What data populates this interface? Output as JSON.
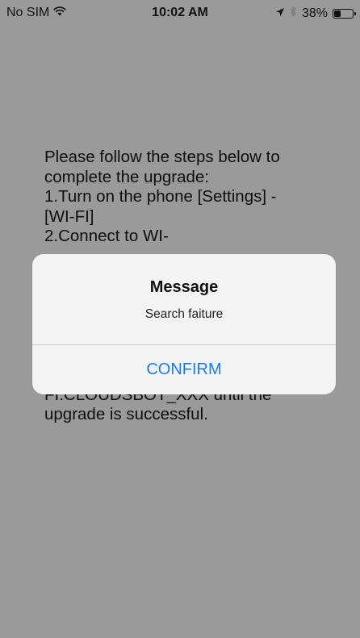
{
  "status_bar": {
    "carrier": "No SIM",
    "time": "10:02 AM",
    "battery_percent": "38%",
    "battery_level": 0.38,
    "icons": [
      "wifi-icon",
      "location-arrow-icon",
      "bluetooth-icon",
      "battery-icon"
    ]
  },
  "instructions": {
    "lines_top": [
      "Please follow the steps below to",
      "complete the upgrade:",
      "1.Turn on the phone [Settings] -",
      "[WI-FI]",
      "2.Connect to WI-"
    ],
    "lines_bottom": [
      "FI:CLOUDSBOT_XXX until the",
      "upgrade is successful."
    ]
  },
  "alert": {
    "title": "Message",
    "message": "Search faiture",
    "confirm_label": "CONFIRM"
  },
  "colors": {
    "background": "#9a9a9a",
    "alert_background": "#f4f4f4",
    "accent": "#1a7cf2"
  }
}
